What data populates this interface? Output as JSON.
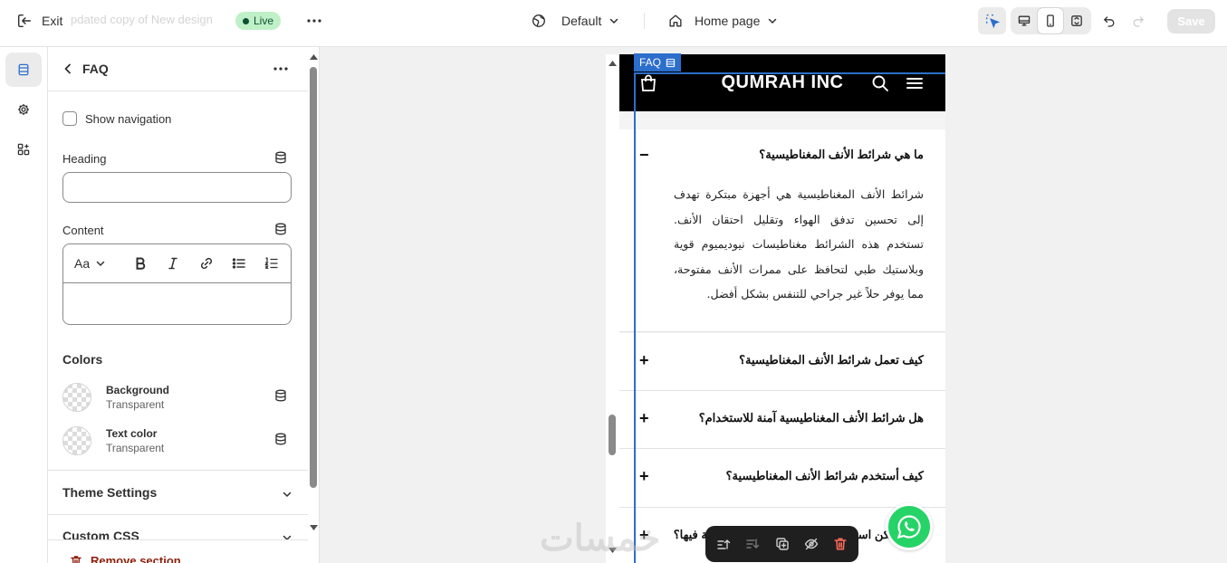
{
  "topbar": {
    "exit_label": "Exit",
    "document_name": "pdated copy of New design",
    "live_badge": "Live",
    "theme_selector": "Default",
    "page_selector": "Home page",
    "save_label": "Save"
  },
  "panel": {
    "title": "FAQ",
    "show_navigation_label": "Show navigation",
    "heading_label": "Heading",
    "heading_value": "",
    "content_label": "Content",
    "rte_font_label": "Aa",
    "colors_title": "Colors",
    "colors": [
      {
        "name": "Background",
        "value": "Transparent"
      },
      {
        "name": "Text color",
        "value": "Transparent"
      }
    ],
    "theme_settings_label": "Theme Settings",
    "custom_css_label": "Custom CSS",
    "remove_section_label": "Remove section"
  },
  "preview": {
    "section_tag": "FAQ",
    "store_name": "QUMRAH INC",
    "faq": [
      {
        "question": "ما هي شرائط الأنف المغناطيسية؟",
        "toggle": "−",
        "answer": "شرائط الأنف المغناطيسية هي أجهزة مبتكرة تهدف إلى تحسين تدفق الهواء وتقليل احتقان الأنف. تستخدم هذه الشرائط مغناطيسات نيوديميوم قوية وبلاستيك طبي لتحافظ على ممرات الأنف مفتوحة، مما يوفر حلاً غير جراحي للتنفس بشكل أفضل."
      },
      {
        "question": "كيف تعمل شرائط الأنف المغناطيسية؟",
        "toggle": "+"
      },
      {
        "question": "هل شرائط الأنف المغناطيسية آمنة للاستخدام؟",
        "toggle": "+"
      },
      {
        "question": "كيف أستخدم شرائط الأنف المغناطيسية؟",
        "toggle": "+"
      },
      {
        "question": "التي يمكن استخدام شرائط الأنف المغناطيسية فيها؟",
        "toggle": "+"
      }
    ],
    "watermark": "خمسات"
  },
  "colors": {
    "accent": "#2c6ecb",
    "live_bg": "#bff0c7",
    "live_text": "#0c5132",
    "remove": "#8e1f0b",
    "whatsapp": "#25d366"
  }
}
